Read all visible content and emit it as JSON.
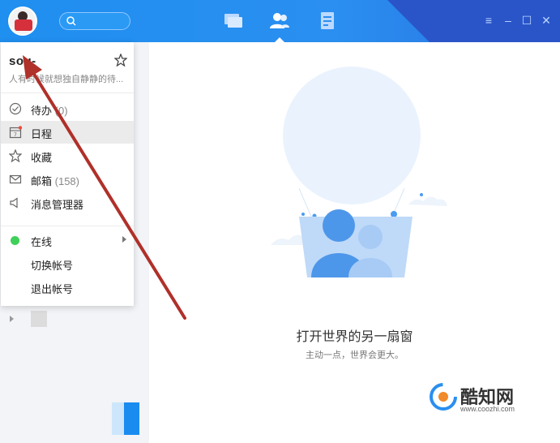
{
  "user": {
    "name": "sou-",
    "signature": "人有时候就想独自静静的待..."
  },
  "menu": {
    "items": [
      {
        "id": "todo",
        "label": "待办",
        "count": "(0)",
        "icon": "check-circle-icon"
      },
      {
        "id": "schedule",
        "label": "日程",
        "count": "",
        "icon": "calendar-icon",
        "selected": true
      },
      {
        "id": "favorites",
        "label": "收藏",
        "count": "",
        "icon": "star-outline-icon"
      },
      {
        "id": "mail",
        "label": "邮箱",
        "count": "(158)",
        "icon": "mail-icon"
      },
      {
        "id": "messages",
        "label": "消息管理器",
        "count": "",
        "icon": "speaker-icon"
      }
    ],
    "status": {
      "label": "在线",
      "color": "#40d05a"
    },
    "switch_account": "切换帐号",
    "logout": "退出帐号"
  },
  "empty_state": {
    "title": "打开世界的另一扇窗",
    "subtitle": "主动一点，世界会更大。"
  },
  "watermark": {
    "name": "酷知网",
    "url": "www.coozhi.com"
  },
  "colors": {
    "titlebar": "#1f8ff0",
    "accent_dark": "#2a55c9",
    "arrow": "#b0302a"
  }
}
